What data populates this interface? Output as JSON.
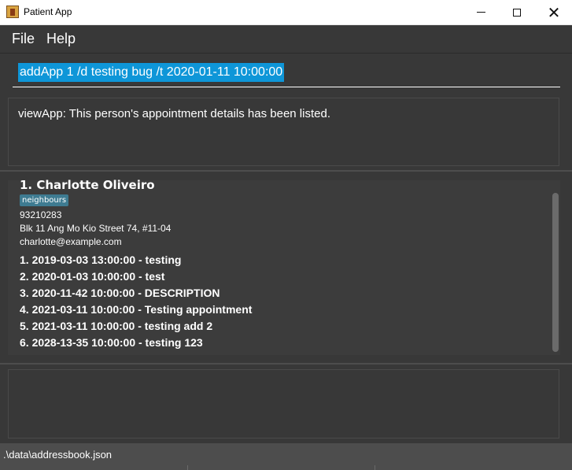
{
  "window": {
    "title": "Patient App",
    "close_glyph": "✕"
  },
  "menu": {
    "items": [
      {
        "label": "File"
      },
      {
        "label": "Help"
      }
    ]
  },
  "command": {
    "value": "addApp 1 /d testing bug /t 2020-01-11 10:00:00"
  },
  "result": {
    "message": "viewApp: This person's appointment details has been listed."
  },
  "person": {
    "name": "1.  Charlotte Oliveiro",
    "tag": "neighbours",
    "phone": "93210283",
    "address": "Blk 11 Ang Mo Kio Street 74, #11-04",
    "email": "charlotte@example.com",
    "appointments": [
      "1. 2019-03-03 13:00:00 - testing",
      "2. 2020-01-03 10:00:00 - test",
      "3. 2020-11-42 10:00:00 - DESCRIPTION",
      "4. 2021-03-11 10:00:00 - Testing appointment",
      "5. 2021-03-11 10:00:00 - testing add 2",
      "6. 2028-13-35 10:00:00 - testing 123"
    ]
  },
  "status": {
    "path": ".\\data\\addressbook.json"
  },
  "colors": {
    "background": "#383838",
    "selection": "#0e96d8",
    "tag": "#3e7b91"
  }
}
